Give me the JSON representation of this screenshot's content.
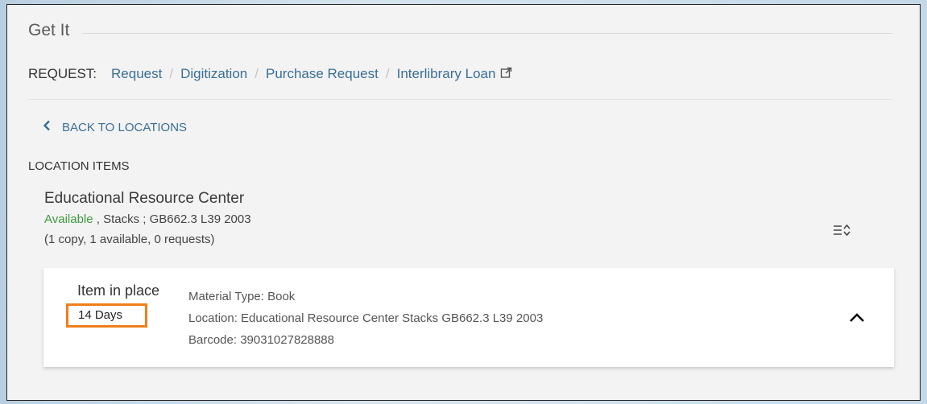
{
  "header": {
    "title": "Get It"
  },
  "request": {
    "label": "REQUEST:",
    "links": [
      "Request",
      "Digitization",
      "Purchase Request",
      "Interlibrary Loan"
    ],
    "separator": "/"
  },
  "back": {
    "label": "BACK TO LOCATIONS"
  },
  "location_items_label": "LOCATION ITEMS",
  "location": {
    "name": "Educational Resource Center",
    "availability": "Available",
    "details": " , Stacks ; GB662.3 L39 2003",
    "counts": "(1 copy, 1 available, 0 requests)"
  },
  "item": {
    "status": "Item in place",
    "due": "14 Days",
    "material_type": "Material Type: Book",
    "location": "Location: Educational Resource Center Stacks GB662.3 L39 2003",
    "barcode": "Barcode: 39031027828888"
  },
  "icons": {
    "back": "chevron-left-icon",
    "external": "external-link-icon",
    "sort": "sort-icon",
    "collapse": "chevron-up-icon"
  },
  "colors": {
    "link": "#3a6e96",
    "available": "#3e9a3e",
    "highlight": "#f07e1a"
  }
}
